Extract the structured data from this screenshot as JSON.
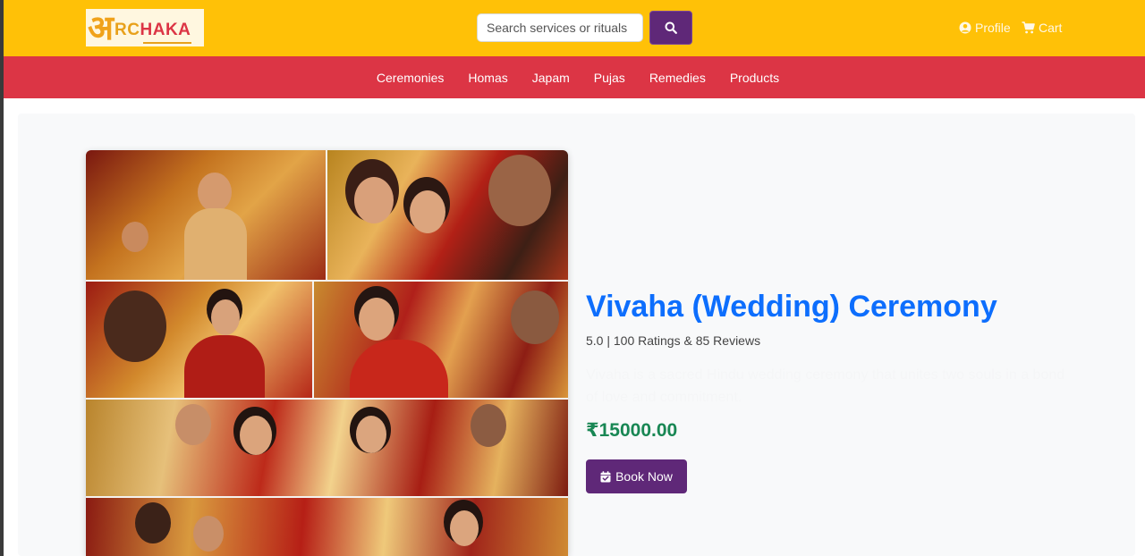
{
  "header": {
    "logo": {
      "glyph": "अ",
      "text_part1": "RC",
      "text_part2": "HAKA"
    },
    "search": {
      "placeholder": "Search services or rituals",
      "value": "",
      "button_icon": "search-icon"
    },
    "profile_label": "Profile",
    "profile_icon": "user-circle-icon",
    "cart_label": "Cart",
    "cart_icon": "cart-icon"
  },
  "nav": {
    "items": [
      {
        "label": "Ceremonies"
      },
      {
        "label": "Homas"
      },
      {
        "label": "Japam"
      },
      {
        "label": "Pujas"
      },
      {
        "label": "Remedies"
      },
      {
        "label": "Products"
      }
    ]
  },
  "product": {
    "title": "Vivaha (Wedding) Ceremony",
    "rating_text": "5.0 | 100 Ratings & 85 Reviews",
    "description": "Vivaha is a sacred Hindu wedding ceremony that unites two souls in a bond of love and commitment.",
    "price": "₹15000.00",
    "book_label": "Book Now",
    "book_icon": "calendar-check-icon"
  },
  "colors": {
    "header_bg": "#ffc107",
    "nav_bg": "#dc3545",
    "title": "#0d6efd",
    "price": "#198754",
    "button": "#5f2878"
  }
}
